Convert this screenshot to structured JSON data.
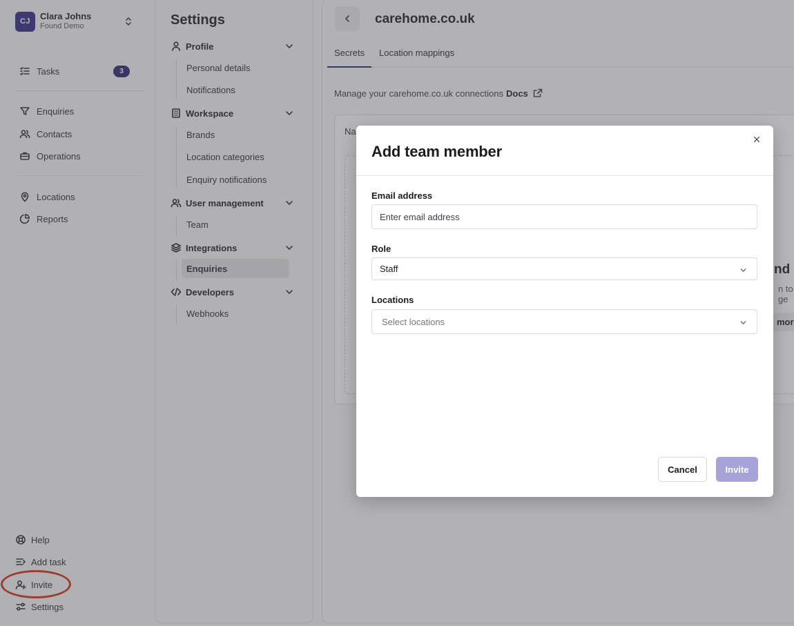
{
  "account": {
    "initials": "CJ",
    "name": "Clara Johns",
    "org": "Found Demo"
  },
  "nav": {
    "tasks": {
      "label": "Tasks",
      "count": "3"
    },
    "enquiries": "Enquiries",
    "contacts": "Contacts",
    "operations": "Operations",
    "locations": "Locations",
    "reports": "Reports",
    "help": "Help",
    "add_task": "Add task",
    "invite": "Invite",
    "settings": "Settings"
  },
  "settings_panel": {
    "title": "Settings",
    "sections": {
      "profile": {
        "label": "Profile",
        "items": [
          "Personal details",
          "Notifications"
        ]
      },
      "workspace": {
        "label": "Workspace",
        "items": [
          "Brands",
          "Location categories",
          "Enquiry notifications"
        ]
      },
      "user_management": {
        "label": "User management",
        "items": [
          "Team"
        ]
      },
      "integrations": {
        "label": "Integrations",
        "items": [
          "Enquiries"
        ]
      },
      "developers": {
        "label": "Developers",
        "items": [
          "Webhooks"
        ]
      }
    }
  },
  "main": {
    "title": "carehome.co.uk",
    "tabs": [
      "Secrets",
      "Location mappings"
    ],
    "description": "Manage your carehome.co.uk connections",
    "docs_link": "Docs",
    "table_header_peek": "Na",
    "peek_title": "nd",
    "peek_text": "n to ge",
    "peek_button": "more"
  },
  "modal": {
    "title": "Add team member",
    "email": {
      "label": "Email address",
      "value": "",
      "placeholder": "Enter email address"
    },
    "role": {
      "label": "Role",
      "value": "Staff"
    },
    "locations": {
      "label": "Locations",
      "placeholder": "Select locations"
    },
    "cancel_label": "Cancel",
    "invite_label": "Invite"
  },
  "colors": {
    "brand": "#27236e",
    "invite_disabled": "#a6a3d8",
    "annotation": "#d22d1a"
  }
}
